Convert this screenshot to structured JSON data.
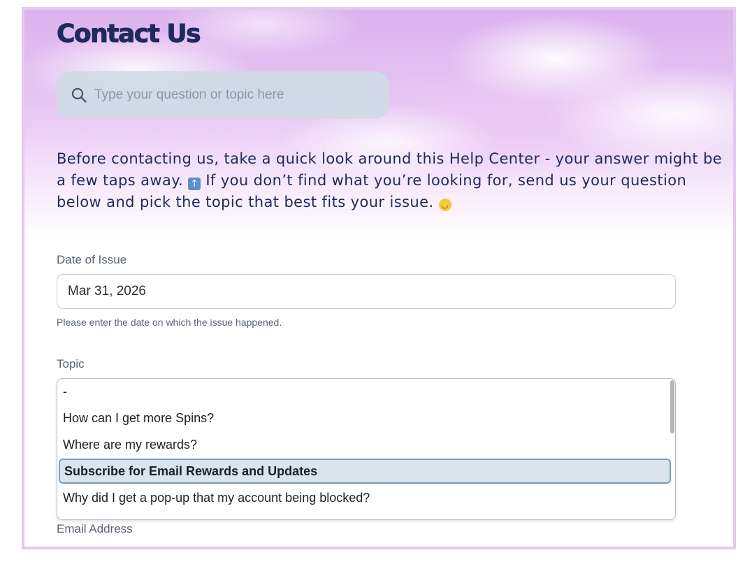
{
  "page": {
    "title": "Contact Us"
  },
  "search": {
    "placeholder": "Type your question or topic here"
  },
  "intro": {
    "text_part1": "Before contacting us, take a quick look around this Help Center - your answer might be a few taps away.",
    "text_part2": "If you don’t find what you’re looking for, send us your question below and pick the topic that best fits your issue."
  },
  "form": {
    "date_label": "Date of Issue",
    "date_value": "Mar 31, 2026",
    "date_hint": "Please enter the date on which the issue happened.",
    "topic_label": "Topic",
    "topic_options": [
      "-",
      "How can I get more Spins?",
      "Where are my rewards?",
      "Subscribe for Email Rewards and Updates",
      "Why did I get a pop-up that my account being blocked?"
    ],
    "topic_selected": "Subscribe for Email Rewards and Updates",
    "email_label": "Email Address"
  },
  "icons": {
    "search": "search-icon",
    "up_arrow_emoji": "up-arrow-emoji-icon",
    "smile_emoji": "smile-emoji-icon"
  },
  "colors": {
    "title": "#1e2a5e",
    "frame_border": "#e3c8f2",
    "selected_option_bg": "#d9e4ec",
    "selected_option_border": "#7d9bbb"
  }
}
